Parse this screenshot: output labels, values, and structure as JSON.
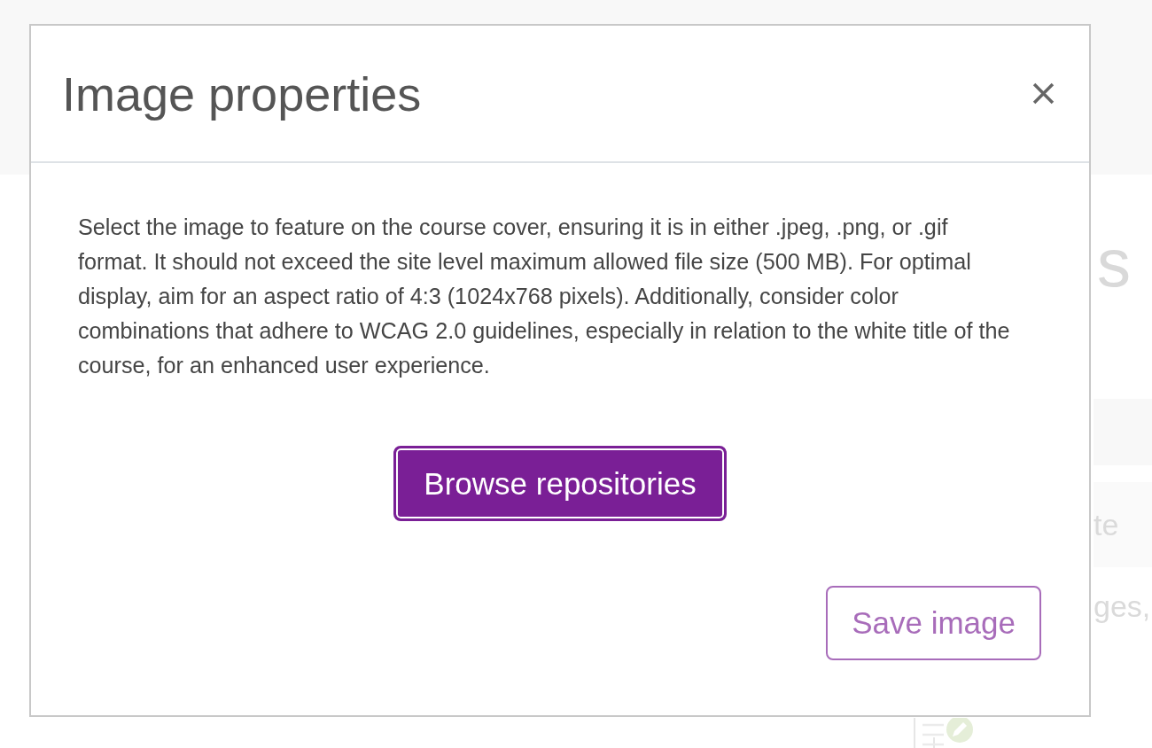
{
  "background": {
    "heading_fragment": "s",
    "row_fragments": [
      "te",
      "ges,"
    ]
  },
  "dialog": {
    "title": "Image properties",
    "description": "Select the image to feature on the course cover, ensuring it is in either .jpeg, .png, or .gif format. It should not exceed the site level maximum allowed file size (500 MB). For optimal display, aim for an aspect ratio of 4:3 (1024x768 pixels). Additionally, consider color combinations that adhere to WCAG 2.0 guidelines, especially in relation to the white title of the course, for an enhanced user experience.",
    "buttons": [
      {
        "label": "Browse repositories",
        "kind": "primary",
        "focused": true,
        "disabled": false
      },
      {
        "label": "Save image",
        "kind": "secondary",
        "focused": false,
        "disabled": true
      }
    ]
  }
}
